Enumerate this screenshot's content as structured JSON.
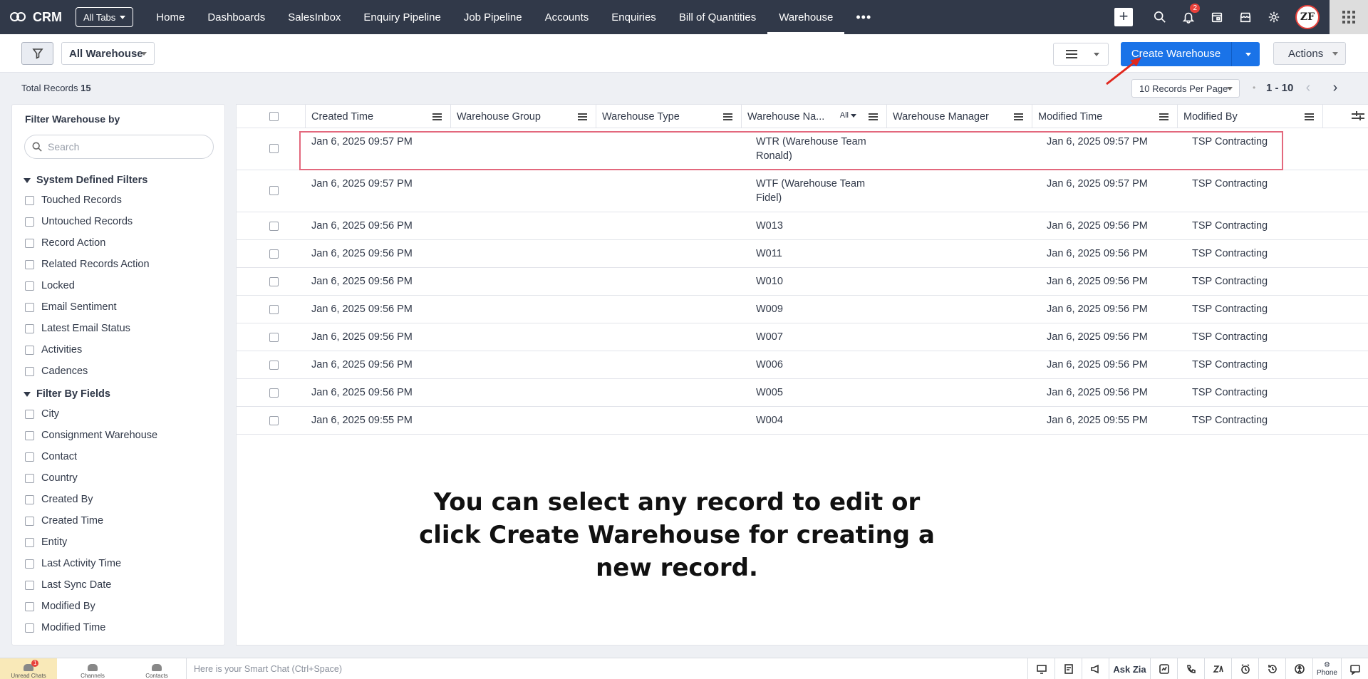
{
  "app": {
    "brand": "CRM",
    "all_tabs_label": "All Tabs"
  },
  "nav": {
    "tabs": [
      "Home",
      "Dashboards",
      "SalesInbox",
      "Enquiry Pipeline",
      "Job Pipeline",
      "Accounts",
      "Enquiries",
      "Bill of Quantities",
      "Warehouse"
    ],
    "active": "Warehouse",
    "more": "•••"
  },
  "topbar": {
    "notification_count": "2",
    "avatar_initials": "ZF",
    "accent_color": "#313949"
  },
  "toolbar": {
    "view_label": "All Warehouse",
    "create_label": "Create Warehouse",
    "actions_label": "Actions",
    "create_color": "#1a73e8"
  },
  "records": {
    "total_label": "Total Records",
    "total_count": "15",
    "per_page": "10 Records Per Page",
    "page_dot": "•",
    "range": "1 - 10"
  },
  "sidebar": {
    "title": "Filter Warehouse by",
    "search_placeholder": "Search",
    "system_section": "System Defined Filters",
    "system_items": [
      "Touched Records",
      "Untouched Records",
      "Record Action",
      "Related Records Action",
      "Locked",
      "Email Sentiment",
      "Latest Email Status",
      "Activities",
      "Cadences"
    ],
    "fields_section": "Filter By Fields",
    "field_items": [
      "City",
      "Consignment Warehouse",
      "Contact",
      "Country",
      "Created By",
      "Created Time",
      "Entity",
      "Last Activity Time",
      "Last Sync Date",
      "Modified By",
      "Modified Time"
    ]
  },
  "table": {
    "columns": [
      "Created Time",
      "Warehouse Group",
      "Warehouse Type",
      "Warehouse Na...",
      "Warehouse Manager",
      "Modified Time",
      "Modified By"
    ],
    "name_filter": "All",
    "rows": [
      {
        "created": "Jan 6, 2025 09:57 PM",
        "name": "WTR (Warehouse Team Ronald)",
        "modified": "Jan 6, 2025 09:57 PM",
        "by": "TSP Contracting"
      },
      {
        "created": "Jan 6, 2025 09:57 PM",
        "name": "WTF (Warehouse Team Fidel)",
        "modified": "Jan 6, 2025 09:57 PM",
        "by": "TSP Contracting"
      },
      {
        "created": "Jan 6, 2025 09:56 PM",
        "name": "W013",
        "modified": "Jan 6, 2025 09:56 PM",
        "by": "TSP Contracting"
      },
      {
        "created": "Jan 6, 2025 09:56 PM",
        "name": "W011",
        "modified": "Jan 6, 2025 09:56 PM",
        "by": "TSP Contracting"
      },
      {
        "created": "Jan 6, 2025 09:56 PM",
        "name": "W010",
        "modified": "Jan 6, 2025 09:56 PM",
        "by": "TSP Contracting"
      },
      {
        "created": "Jan 6, 2025 09:56 PM",
        "name": "W009",
        "modified": "Jan 6, 2025 09:56 PM",
        "by": "TSP Contracting"
      },
      {
        "created": "Jan 6, 2025 09:56 PM",
        "name": "W007",
        "modified": "Jan 6, 2025 09:56 PM",
        "by": "TSP Contracting"
      },
      {
        "created": "Jan 6, 2025 09:56 PM",
        "name": "W006",
        "modified": "Jan 6, 2025 09:56 PM",
        "by": "TSP Contracting"
      },
      {
        "created": "Jan 6, 2025 09:56 PM",
        "name": "W005",
        "modified": "Jan 6, 2025 09:56 PM",
        "by": "TSP Contracting"
      },
      {
        "created": "Jan 6, 2025 09:55 PM",
        "name": "W004",
        "modified": "Jan 6, 2025 09:55 PM",
        "by": "TSP Contracting"
      }
    ]
  },
  "annotation": {
    "text": "You can select any record to edit or click Create Warehouse for creating a new record.",
    "highlight_color": "#e3687d"
  },
  "bottombar": {
    "unread_label": "Unread Chats",
    "unread_count": "1",
    "channels_label": "Channels",
    "contacts_label": "Contacts",
    "smart_chat_placeholder": "Here is your Smart Chat (Ctrl+Space)",
    "ask_zia": "Ask Zia",
    "phone_label": "Phone"
  }
}
